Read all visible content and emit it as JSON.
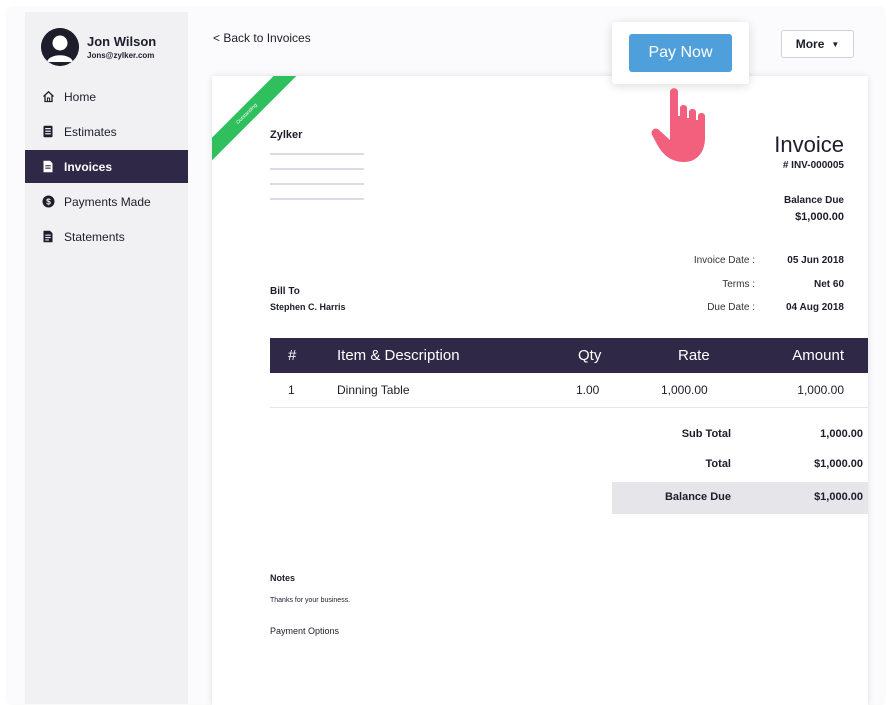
{
  "user": {
    "name": "Jon Wilson",
    "email": "Jons@zylker.com"
  },
  "nav": [
    {
      "label": "Home",
      "icon": "home-icon"
    },
    {
      "label": "Estimates",
      "icon": "estimate-icon"
    },
    {
      "label": "Invoices",
      "icon": "invoice-icon",
      "active": true
    },
    {
      "label": "Payments Made",
      "icon": "dollar-circle-icon"
    },
    {
      "label": "Statements",
      "icon": "statement-icon"
    }
  ],
  "toolbar": {
    "back_label": "< Back to Invoices",
    "more_label": "More",
    "pay_now_label": "Pay Now"
  },
  "invoice": {
    "status": "Outstanding",
    "org": "Zylker",
    "title": "Invoice",
    "number": "# INV-000005",
    "balance_due_label": "Balance Due",
    "balance_due_value": "$1,000.00",
    "invoice_date_label": "Invoice Date :",
    "invoice_date": "05 Jun 2018",
    "terms_label": "Terms :",
    "terms": "Net 60",
    "due_date_label": "Due Date :",
    "due_date": "04 Aug 2018",
    "bill_to_label": "Bill To",
    "bill_to_name": "Stephen C. Harris",
    "columns": {
      "num": "#",
      "item": "Item & Description",
      "qty": "Qty",
      "rate": "Rate",
      "amount": "Amount"
    },
    "items": [
      {
        "num": "1",
        "item": "Dinning Table",
        "qty": "1.00",
        "rate": "1,000.00",
        "amount": "1,000.00"
      }
    ],
    "sub_total_label": "Sub Total",
    "sub_total": "1,000.00",
    "total_label": "Total",
    "total": "$1,000.00",
    "final_balance_label": "Balance Due",
    "final_balance": "$1,000.00",
    "notes_label": "Notes",
    "notes_text": "Thanks for your business.",
    "payment_options_label": "Payment Options"
  },
  "colors": {
    "accent_dark": "#2f2847",
    "pay_button": "#4f9fda",
    "status_ribbon": "#2fbf5c",
    "hand": "#f2607e"
  }
}
